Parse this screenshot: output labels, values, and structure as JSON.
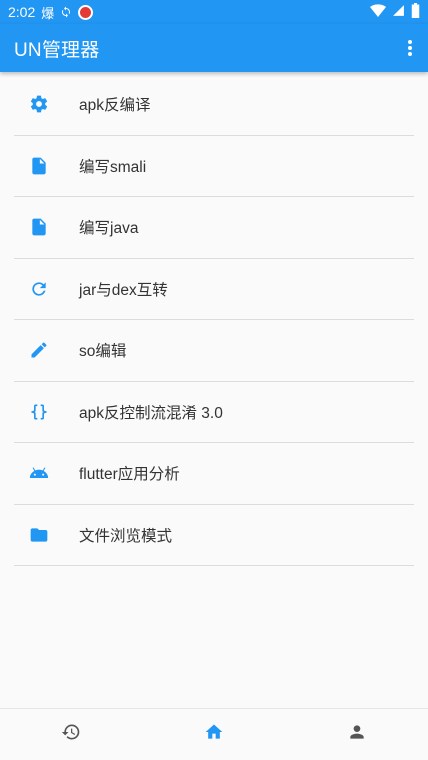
{
  "status_bar": {
    "time": "2:02",
    "indicators": [
      "爆",
      "signal-icon",
      "wifi-icon",
      "battery-icon"
    ]
  },
  "app_bar": {
    "title": "UN管理器",
    "menu_icon": "more-vert-icon"
  },
  "menu": [
    {
      "label": "apk反编译",
      "icon": "settings-icon"
    },
    {
      "label": "编写smali",
      "icon": "file-icon"
    },
    {
      "label": "编写java",
      "icon": "file-icon"
    },
    {
      "label": "jar与dex互转",
      "icon": "refresh-icon"
    },
    {
      "label": "so编辑",
      "icon": "pencil-icon"
    },
    {
      "label": "apk反控制流混淆 3.0",
      "icon": "code-braces-icon"
    },
    {
      "label": "flutter应用分析",
      "icon": "android-icon"
    },
    {
      "label": "文件浏览模式",
      "icon": "folder-icon"
    }
  ],
  "bottom_nav": {
    "items": [
      {
        "icon": "history-icon",
        "active": false
      },
      {
        "icon": "home-icon",
        "active": true
      },
      {
        "icon": "person-icon",
        "active": false
      }
    ]
  },
  "colors": {
    "primary": "#2196f3",
    "text": "#333333",
    "inactive_icon": "#555555"
  }
}
